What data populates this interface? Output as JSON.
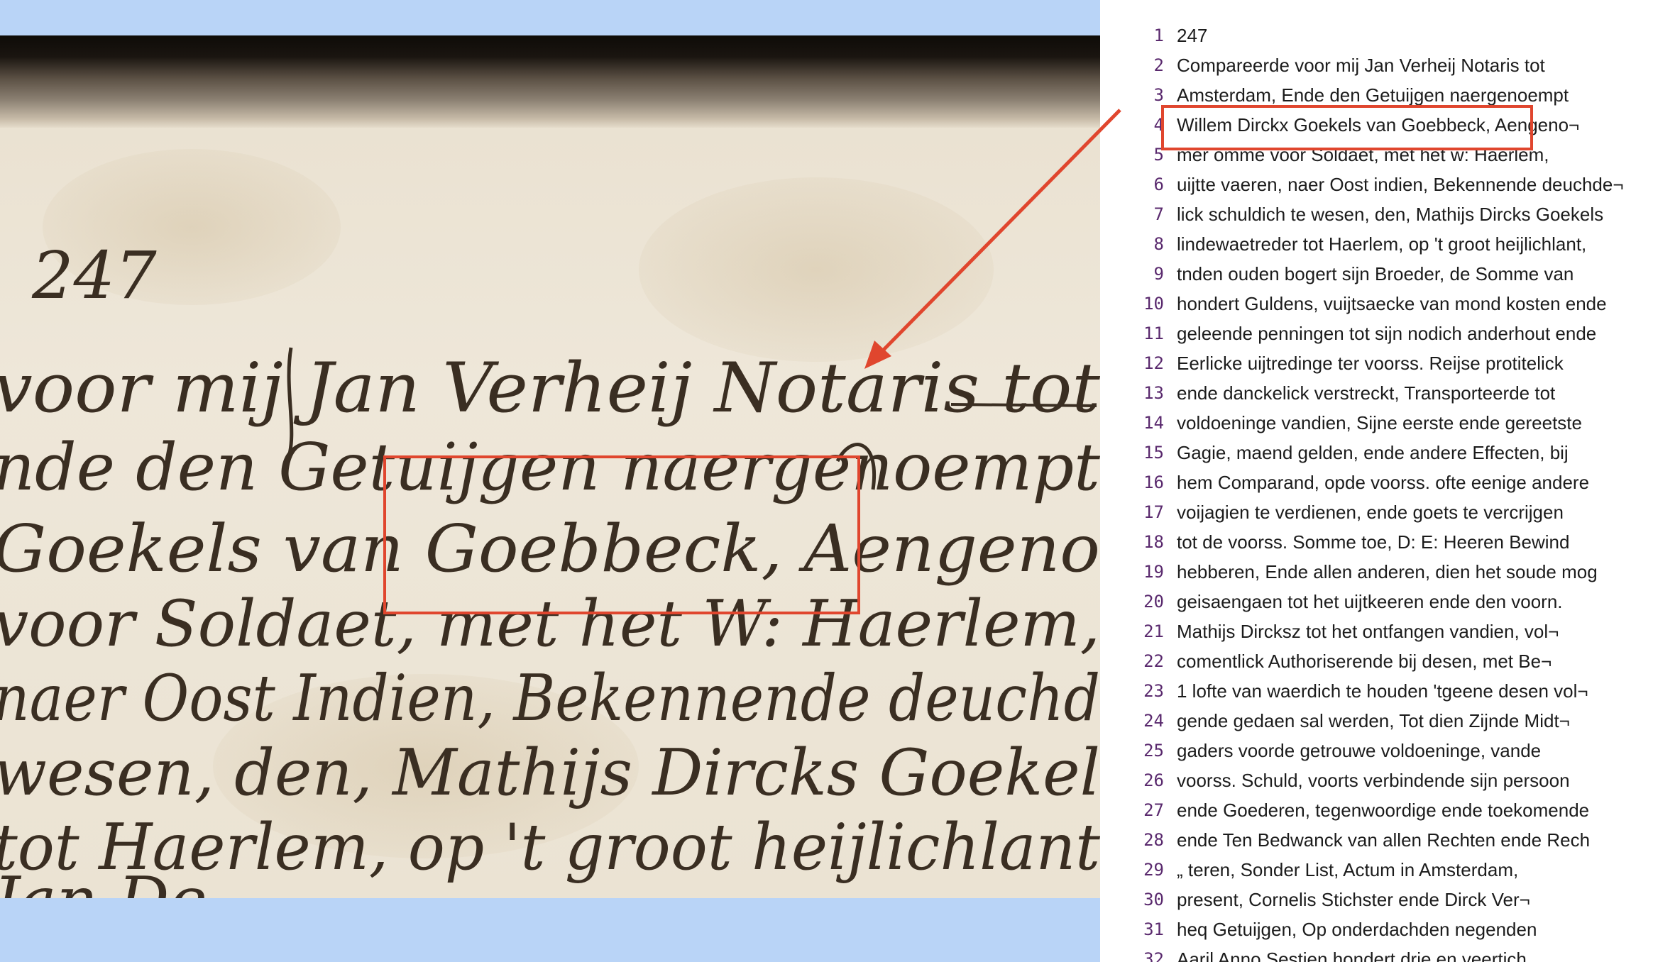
{
  "scan": {
    "handwriting": [
      "247",
      "voor mij Jan Verheij Notaris tot",
      "nde den Getuijgen naergenoempt",
      "Goekels van Goebbeck, Aengeno",
      "voor Soldaet, met het W: Haerlem,",
      "naer Oost Indien, Bekennende deuchd",
      "wesen, den, Mathijs Dircks Goekel",
      "tot Haerlem, op 't groot heijlichlant",
      "Jan De"
    ]
  },
  "transcription": {
    "lines": [
      {
        "n": "1",
        "text": "247"
      },
      {
        "n": "2",
        "text": "Compareerde voor mij Jan Verheij Notaris tot"
      },
      {
        "n": "3",
        "text": "Amsterdam, Ende den Getuijgen naergenoempt"
      },
      {
        "n": "4",
        "text": "Willem Dirckx Goekels van Goebbeck, Aengeno¬"
      },
      {
        "n": "5",
        "text": "mer omme voor Soldaet, met het w: Haerlem,"
      },
      {
        "n": "6",
        "text": "uijtte vaeren, naer Oost indien, Bekennende deuchde¬"
      },
      {
        "n": "7",
        "text": "lick schuldich te wesen, den, Mathijs Dircks Goekels"
      },
      {
        "n": "8",
        "text": "lindewaetreder tot Haerlem, op 't groot heijlichlant,"
      },
      {
        "n": "9",
        "text": "tnden ouden bogert sijn Broeder, de Somme van"
      },
      {
        "n": "10",
        "text": "hondert Guldens, vuijtsaecke van mond kosten ende"
      },
      {
        "n": "11",
        "text": "geleende penningen tot sijn nodich anderhout ende"
      },
      {
        "n": "12",
        "text": "Eerlicke uijtredinge ter voorss. Reijse protitelick"
      },
      {
        "n": "13",
        "text": "ende danckelick verstreckt, Transporteerde tot"
      },
      {
        "n": "14",
        "text": "voldoeninge vandien, Sijne eerste ende gereetste"
      },
      {
        "n": "15",
        "text": "Gagie, maend gelden, ende andere Effecten, bij"
      },
      {
        "n": "16",
        "text": "hem Comparand, opde voorss. ofte eenige andere"
      },
      {
        "n": "17",
        "text": "voijagien te verdienen, ende goets te vercrijgen"
      },
      {
        "n": "18",
        "text": "tot de voorss. Somme toe, D: E: Heeren Bewind"
      },
      {
        "n": "19",
        "text": "hebberen, Ende allen anderen, dien het soude mog"
      },
      {
        "n": "20",
        "text": "geisaengaen tot het uijtkeeren ende den voorn."
      },
      {
        "n": "21",
        "text": "Mathijs Dircksz tot het ontfangen vandien, vol¬"
      },
      {
        "n": "22",
        "text": "comentlick Authoriserende bij desen, met Be¬"
      },
      {
        "n": "23",
        "text": "1 lofte van waerdich te houden 'tgeene desen vol¬"
      },
      {
        "n": "24",
        "text": "gende gedaen sal werden, Tot dien Zijnde Midt¬"
      },
      {
        "n": "25",
        "text": "gaders voorde getrouwe voldoeninge, vande"
      },
      {
        "n": "26",
        "text": "voorss. Schuld, voorts verbindende sijn persoon"
      },
      {
        "n": "27",
        "text": "ende Goederen, tegenwoordige ende toekomende"
      },
      {
        "n": "28",
        "text": "ende Ten Bedwanck van allen Rechten ende Rech"
      },
      {
        "n": "29",
        "text": "„ teren, Sonder List, Actum in Amsterdam,"
      },
      {
        "n": "30",
        "text": "present, Cornelis Stichster ende Dirck Ver¬"
      },
      {
        "n": "31",
        "text": "heq Getuijgen, Op onderdachden negenden"
      },
      {
        "n": "32",
        "text": "Aaril Anno Sestien hondert drie en veertich"
      }
    ]
  },
  "annotation": {
    "color": "#e0462e"
  }
}
